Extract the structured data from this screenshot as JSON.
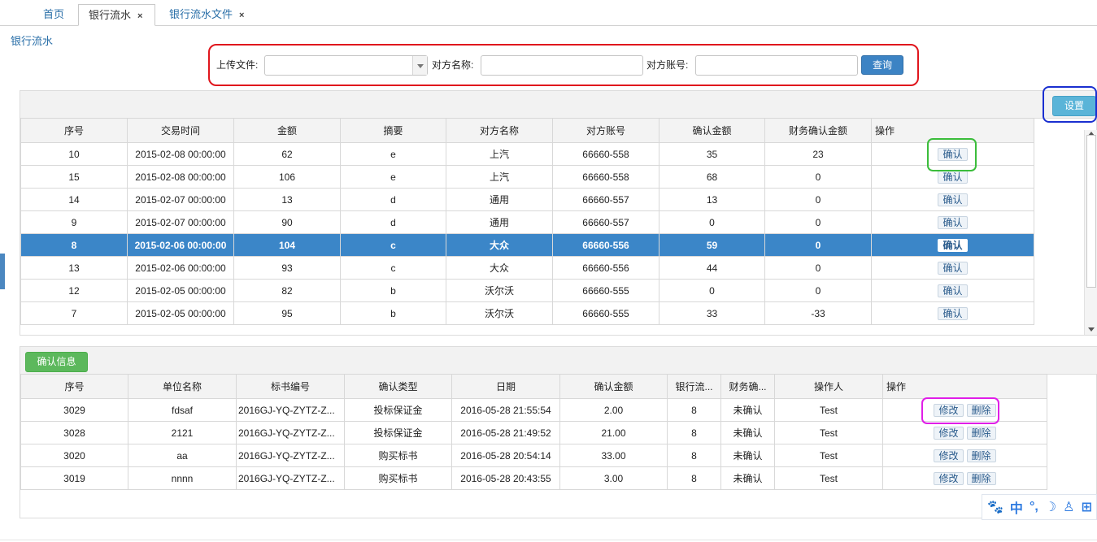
{
  "tabs": [
    {
      "label": "首页"
    },
    {
      "label": "银行流水",
      "close": "×"
    },
    {
      "label": "银行流水文件",
      "close": "×"
    }
  ],
  "breadcrumb": "银行流水",
  "search": {
    "upload_label": "上传文件:",
    "upload_value": "",
    "name_label": "对方名称:",
    "name_value": "",
    "account_label": "对方账号:",
    "account_value": "",
    "query_button": "查询"
  },
  "settings_button": "设置",
  "flow_table": {
    "headers": [
      "序号",
      "交易时间",
      "金额",
      "摘要",
      "对方名称",
      "对方账号",
      "确认金额",
      "财务确认金额",
      "操作"
    ],
    "action_label": "确认",
    "rows": [
      [
        "10",
        "2015-02-08 00:00:00",
        "62",
        "e",
        "上汽",
        "66660-558",
        "35",
        "23"
      ],
      [
        "15",
        "2015-02-08 00:00:00",
        "106",
        "e",
        "上汽",
        "66660-558",
        "68",
        "0"
      ],
      [
        "14",
        "2015-02-07 00:00:00",
        "13",
        "d",
        "通用",
        "66660-557",
        "13",
        "0"
      ],
      [
        "9",
        "2015-02-07 00:00:00",
        "90",
        "d",
        "通用",
        "66660-557",
        "0",
        "0"
      ],
      [
        "8",
        "2015-02-06 00:00:00",
        "104",
        "c",
        "大众",
        "66660-556",
        "59",
        "0"
      ],
      [
        "13",
        "2015-02-06 00:00:00",
        "93",
        "c",
        "大众",
        "66660-556",
        "44",
        "0"
      ],
      [
        "12",
        "2015-02-05 00:00:00",
        "82",
        "b",
        "沃尔沃",
        "66660-555",
        "0",
        "0"
      ],
      [
        "7",
        "2015-02-05 00:00:00",
        "95",
        "b",
        "沃尔沃",
        "66660-555",
        "33",
        "-33"
      ]
    ],
    "selected_row": 4
  },
  "confirm_panel": {
    "button": "确认信息",
    "headers": [
      "序号",
      "单位名称",
      "标书编号",
      "确认类型",
      "日期",
      "确认金额",
      "银行流...",
      "财务确...",
      "操作人",
      "操作"
    ],
    "edit_label": "修改",
    "delete_label": "删除",
    "rows": [
      [
        "3029",
        "fdsaf",
        "2016GJ-YQ-ZYTZ-Z...",
        "投标保证金",
        "2016-05-28 21:55:54",
        "2.00",
        "8",
        "未确认",
        "Test"
      ],
      [
        "3028",
        "2121",
        "2016GJ-YQ-ZYTZ-Z...",
        "投标保证金",
        "2016-05-28 21:49:52",
        "21.00",
        "8",
        "未确认",
        "Test"
      ],
      [
        "3020",
        "aa",
        "2016GJ-YQ-ZYTZ-Z...",
        "购买标书",
        "2016-05-28 20:54:14",
        "33.00",
        "8",
        "未确认",
        "Test"
      ],
      [
        "3019",
        "nnnn",
        "2016GJ-YQ-ZYTZ-Z...",
        "购买标书",
        "2016-05-28 20:43:55",
        "3.00",
        "8",
        "未确认",
        "Test"
      ]
    ]
  },
  "ime": {
    "paw": "🐾",
    "mode": "中",
    "punct": "°,",
    "moon": "☽",
    "user": "♙",
    "grid": "⊞"
  }
}
